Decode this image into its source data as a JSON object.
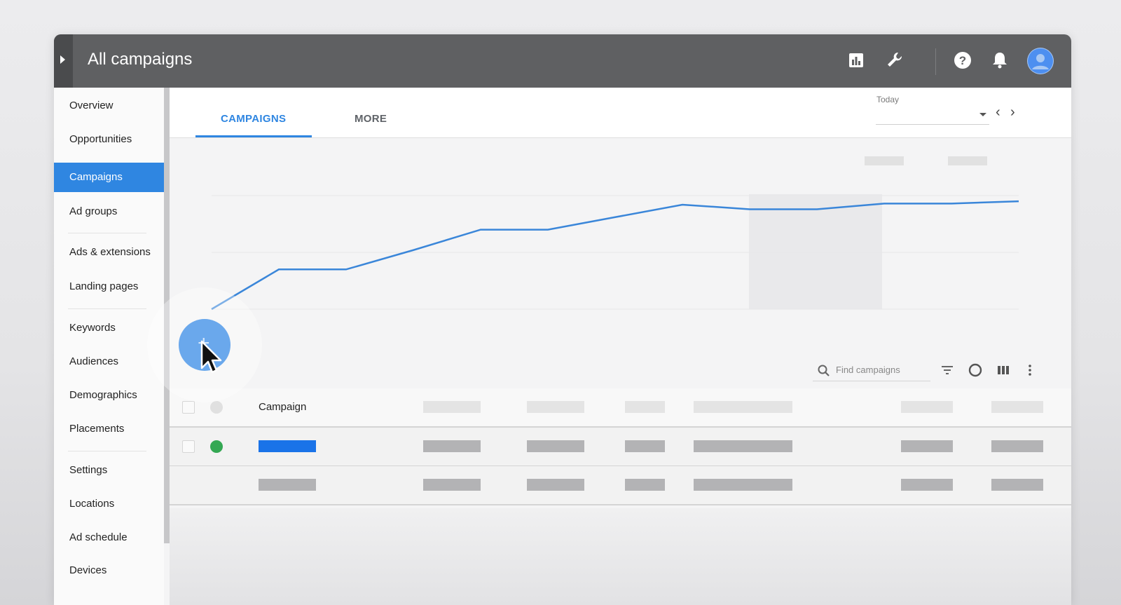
{
  "window": {
    "title": "All campaigns"
  },
  "header": {
    "icons": [
      "reports-icon",
      "tools-wrench-icon",
      "help-icon",
      "notifications-bell-icon",
      "account-avatar"
    ]
  },
  "sidebar": {
    "items": [
      {
        "label": "Overview"
      },
      {
        "label": "Opportunities"
      },
      {
        "label": "Campaigns",
        "active": true
      },
      {
        "label": "Ad groups"
      },
      {
        "label": "Ads & extensions"
      },
      {
        "label": "Landing pages"
      },
      {
        "label": "Keywords"
      },
      {
        "label": "Audiences"
      },
      {
        "label": "Demographics"
      },
      {
        "label": "Placements"
      },
      {
        "label": "Settings"
      },
      {
        "label": "Locations"
      },
      {
        "label": "Ad schedule"
      },
      {
        "label": "Devices"
      }
    ]
  },
  "tabs": [
    {
      "label": "CAMPAIGNS",
      "active": true
    },
    {
      "label": "MORE"
    }
  ],
  "date_range": {
    "label": "Today"
  },
  "chart_data": {
    "type": "line",
    "series": [
      {
        "values": [
          0,
          35,
          35,
          52,
          70,
          70,
          81,
          92,
          88,
          88,
          93,
          93,
          95
        ]
      }
    ],
    "ylim": [
      0,
      100
    ],
    "grid": true,
    "color": "#3a86d9"
  },
  "search": {
    "placeholder": "Find campaigns"
  },
  "table": {
    "header": {
      "campaign_label": "Campaign"
    },
    "rows": [
      {
        "status_color": "#34a853",
        "name_color": "#1a73e8"
      },
      {
        "status_color": null
      }
    ]
  },
  "colors": {
    "accent": "#2f86e1",
    "topbar": "#5f6062",
    "fab": "#6aa8ec"
  },
  "fab": {
    "icon": "add-icon"
  }
}
